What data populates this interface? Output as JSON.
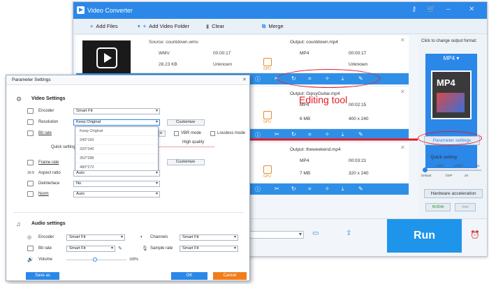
{
  "app": {
    "title": "Video Converter"
  },
  "toolbar": {
    "add_files": "Add Files",
    "add_folder": "Add Video Folder",
    "clear": "Clear",
    "merge": "Merge"
  },
  "rows": [
    {
      "source": "Source: countdown.wmv",
      "src_format": "WMV",
      "src_duration": "00:00:17",
      "src_size": "28.23 KB",
      "src_res": "Unknown",
      "output": "Output: countdown.mp4",
      "out_format": "MP4",
      "out_duration": "00:00:17",
      "out_size": "",
      "out_res": "Unknown"
    },
    {
      "output": "Output: GipsyGuitar.mp4",
      "out_format": "MP4",
      "out_duration": "00:02:15",
      "out_size": "6 MB",
      "out_res": "400 x 240"
    },
    {
      "output": "Output: theweekend.mp4",
      "out_format": "MP4",
      "out_duration": "00:03:21",
      "out_size": "7 MB",
      "out_res": "320 x 240"
    }
  ],
  "gpu_label": "GPU",
  "right_panel": {
    "header": "Click to change output format:",
    "format": "MP4",
    "parameter_settings": "Parameter settings",
    "quick_setting": "Quick setting",
    "q_top": [
      "480P",
      "1080P",
      "4K"
    ],
    "q_bottom": [
      "Default",
      "720P",
      "2K"
    ],
    "hw_accel": "Hardware acceleration",
    "nvidia": "NVIDIA",
    "intel": "Intel"
  },
  "run_label": "Run",
  "annotation": {
    "editing_tool": "Editing tool"
  },
  "dialog": {
    "title": "Parameter Settings",
    "video_settings": "Video Settings",
    "encoder_label": "Encoder",
    "encoder_value": "Smart Fit",
    "resolution_label": "Resolution",
    "resolution_value": "Keep Original",
    "customize": "Customize",
    "bitrate_label": "Bit rate",
    "vbr_mode": "VBR mode",
    "lossless_mode": "Lossless mode",
    "quick_setting": "Quick setting",
    "high_quality": "High quality",
    "resolution_options": [
      "Keep Original",
      "240*160",
      "320*240",
      "352*288",
      "480*272"
    ],
    "framerate_label": "Frame rate",
    "framerate_value": "Auto",
    "aspect_label": "Aspect ratio",
    "aspect_value": "Auto",
    "deinterlace_label": "Deinterlace",
    "deinterlace_value": "No",
    "norm_label": "Norm",
    "norm_value": "Auto",
    "audio_settings": "Audio settings",
    "a_encoder_label": "Encoder",
    "a_encoder_value": "Smart Fit",
    "channels_label": "Channels",
    "channels_value": "Smart Fit",
    "a_bitrate_label": "Bit rate",
    "a_bitrate_value": "Smart Fit",
    "sample_label": "Sample rate",
    "sample_value": "Smart Fit",
    "volume_label": "Volume",
    "volume_value": "100%",
    "save_as": "Save as",
    "ok": "OK",
    "cancel": "Cancel"
  }
}
